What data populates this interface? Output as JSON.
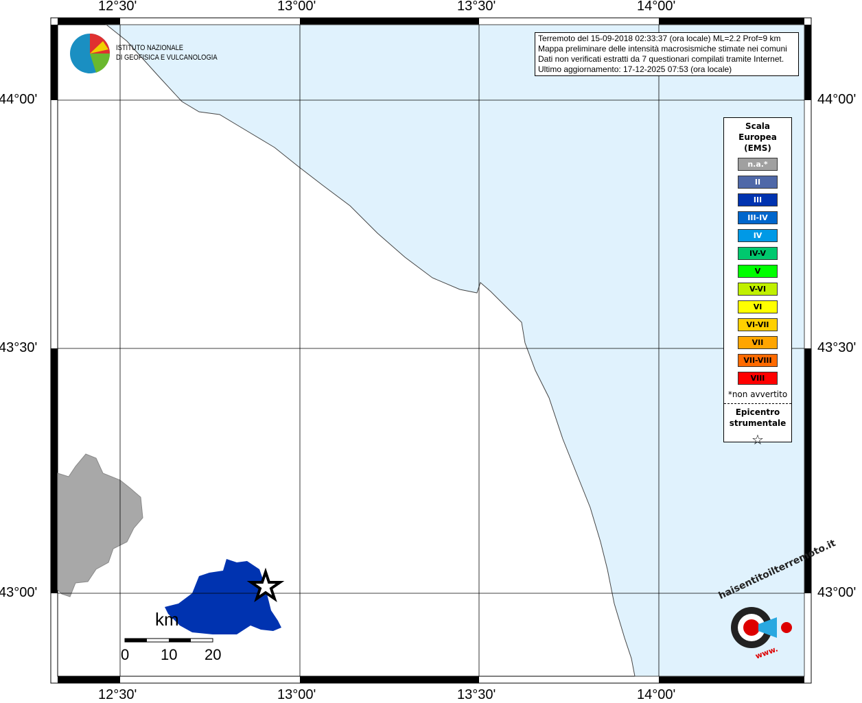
{
  "logo": {
    "line1": "ISTITUTO NAZIONALE",
    "line2": "DI GEOFISICA E VULCANOLOGIA"
  },
  "info": {
    "lines": [
      "Terremoto del 15-09-2018 02:33:37 (ora locale) ML=2.2 Prof=9 km",
      "Mappa preliminare delle intensità macrosismiche stimate nei comuni",
      "Dati non verificati estratti da 7 questionari compilati tramite Internet.",
      "Ultimo aggiornamento: 17-12-2025 07:53 (ora locale)"
    ]
  },
  "lon_ticks": [
    "12°30'",
    "13°00'",
    "13°30'",
    "14°00'"
  ],
  "lat_ticks": [
    "44°00'",
    "43°30'",
    "43°00'"
  ],
  "legend": {
    "title": [
      "Scala",
      "Europea",
      "(EMS)"
    ],
    "items": [
      {
        "label": "n.a.*",
        "color": "#a0a0a0",
        "text": "#ffffff"
      },
      {
        "label": "II",
        "color": "#4f68a8",
        "text": "#ffffff"
      },
      {
        "label": "III",
        "color": "#0033b0",
        "text": "#ffffff"
      },
      {
        "label": "III-IV",
        "color": "#0066cc",
        "text": "#ffffff"
      },
      {
        "label": "IV",
        "color": "#0099e6",
        "text": "#ffffff"
      },
      {
        "label": "IV-V",
        "color": "#00c86e",
        "text": "#000000"
      },
      {
        "label": "V",
        "color": "#00ff00",
        "text": "#000000"
      },
      {
        "label": "V-VI",
        "color": "#c0f000",
        "text": "#000000"
      },
      {
        "label": "VI",
        "color": "#ffff00",
        "text": "#000000"
      },
      {
        "label": "VI-VII",
        "color": "#ffd000",
        "text": "#000000"
      },
      {
        "label": "VII",
        "color": "#ffa500",
        "text": "#000000"
      },
      {
        "label": "VII-VIII",
        "color": "#ff6a00",
        "text": "#000000"
      },
      {
        "label": "VIII",
        "color": "#ff0000",
        "text": "#000000"
      }
    ],
    "note": "*non avvertito",
    "epicenter": [
      "Epicentro",
      "strumentale"
    ],
    "star": "☆"
  },
  "scale": {
    "unit": "km",
    "labels": [
      "0",
      "10",
      "20"
    ]
  },
  "badge": {
    "text": "haisentitoilterremoto.it",
    "www": "www."
  },
  "colors": {
    "sea": "#e0f2fd",
    "intensity_region": "#0033b0",
    "na_region": "#a8a8a8"
  }
}
